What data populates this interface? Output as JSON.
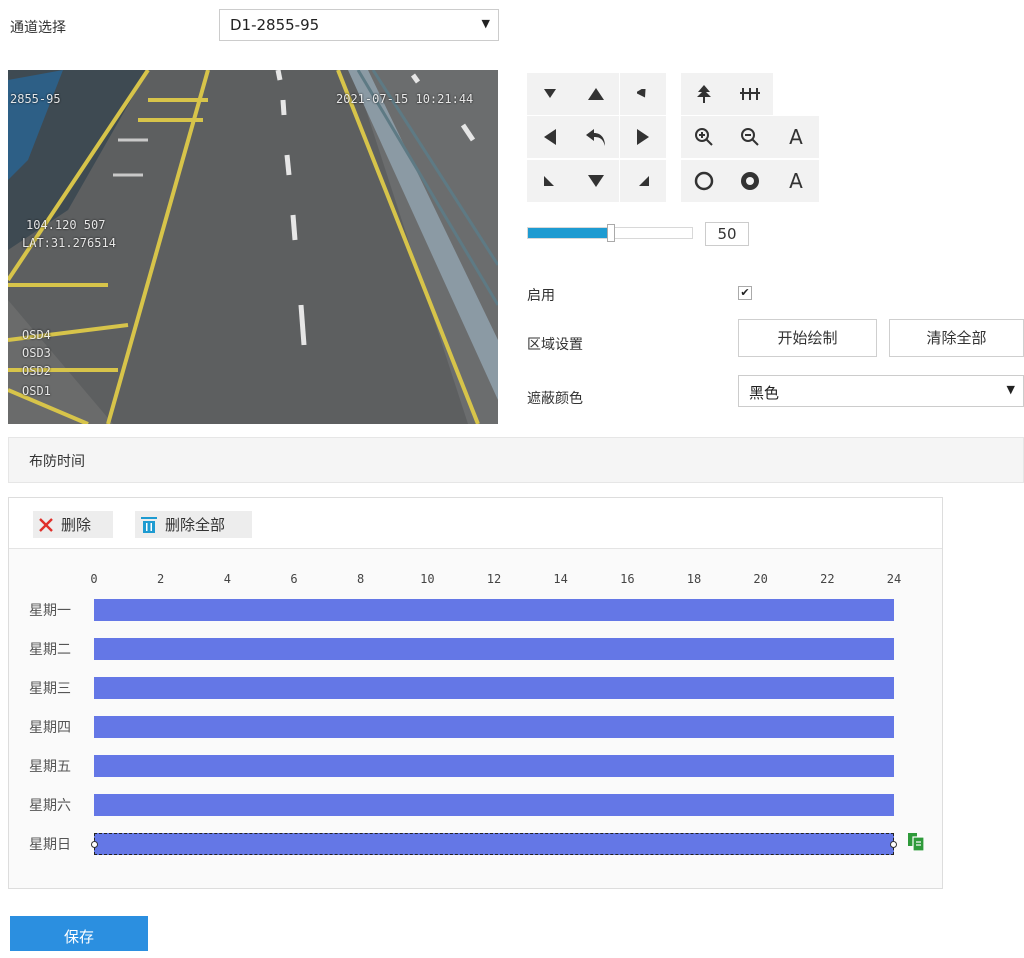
{
  "channel": {
    "label": "通道选择",
    "selected": "D1-2855-95"
  },
  "video": {
    "osd_top_left": "2855-95",
    "osd_timestamp": "2021-07-15 10:21:44",
    "osd_lng": "104.120 507",
    "osd_lat": "LAT:31.276514",
    "osd_lines": [
      "OSD4",
      "OSD3",
      "OSD2",
      "OSD1"
    ]
  },
  "ptz": {
    "zoom_in_label": "A",
    "zoom_out_label": "A",
    "speed_value": "50",
    "speed_fraction": 0.5
  },
  "form": {
    "enable_label": "启用",
    "enable_checked": "✔",
    "region_label": "区域设置",
    "start_draw": "开始绘制",
    "clear_all": "清除全部",
    "mask_color_label": "遮蔽颜色",
    "mask_color_value": "黑色"
  },
  "section": {
    "title": "布防时间"
  },
  "schedule": {
    "delete_label": "删除",
    "delete_all_label": "删除全部",
    "ticks": [
      "0",
      "2",
      "4",
      "6",
      "8",
      "10",
      "12",
      "14",
      "16",
      "18",
      "20",
      "22",
      "24"
    ],
    "days": [
      "星期一",
      "星期二",
      "星期三",
      "星期四",
      "星期五",
      "星期六",
      "星期日"
    ],
    "bar_color": "#6477e6"
  },
  "save_label": "保存",
  "colors": {
    "accent": "#2b8fe0",
    "slider": "#1e9bd1",
    "delete_red": "#e0302a",
    "trash_blue": "#1e9bd1",
    "copy_green": "#2e9a3a"
  }
}
